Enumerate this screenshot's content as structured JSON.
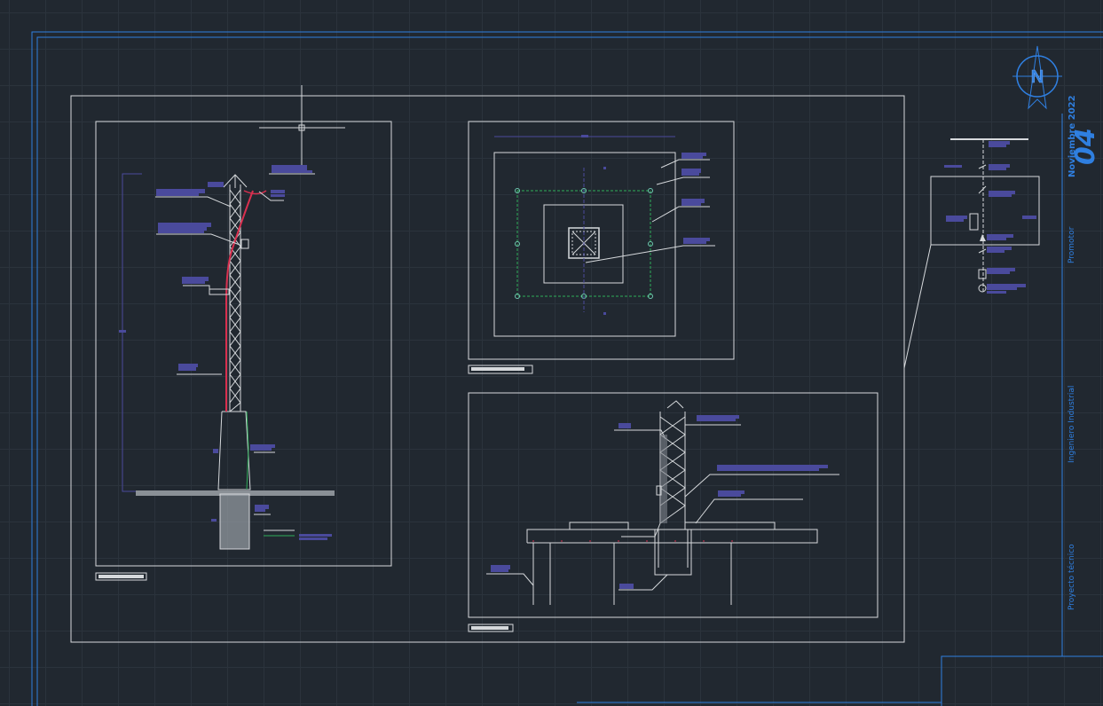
{
  "colors": {
    "background": "#212830",
    "grid": "#2b333c",
    "frame": "#2f7fe0",
    "linework": "#d6d9dc",
    "red_cable": "#d9304f",
    "green_ground": "#2fae5a",
    "label_block": "#4a4a9c"
  },
  "title_block": {
    "sheet_number": "04",
    "date": "Noviembre 2022",
    "promoter": "Promotor",
    "engineer": "Ingeniero Industrial",
    "project": "Proyecto técnico"
  },
  "north_arrow": {
    "letter": "N",
    "icon": "north-arrow-icon"
  }
}
